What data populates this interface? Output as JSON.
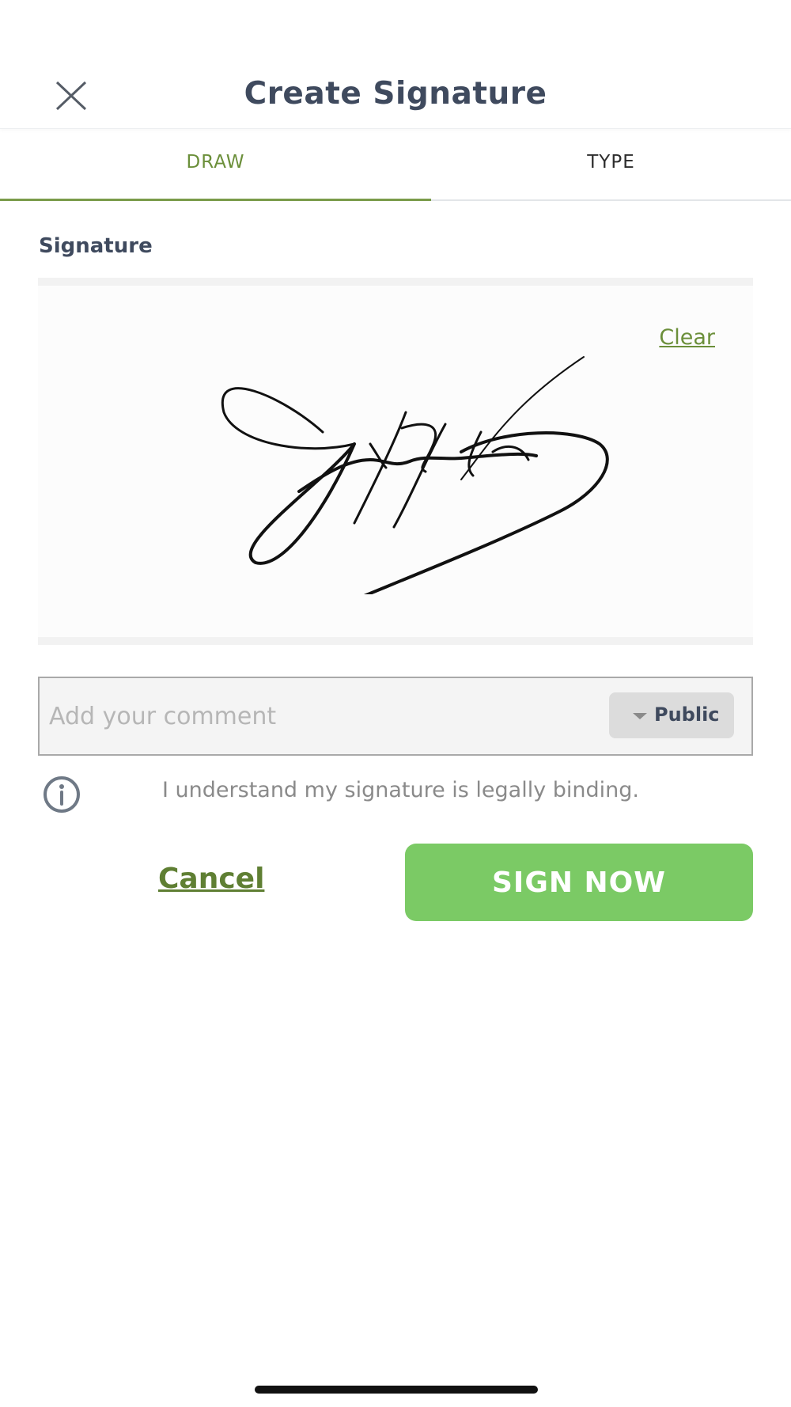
{
  "header": {
    "title": "Create Signature"
  },
  "tabs": [
    {
      "label": "DRAW",
      "active": true
    },
    {
      "label": "TYPE",
      "active": false
    }
  ],
  "signature": {
    "section_label": "Signature",
    "clear_label": "Clear"
  },
  "comment": {
    "placeholder": "Add your comment",
    "value": "",
    "visibility": "Public"
  },
  "legal": {
    "notice": "I understand my signature is legally binding."
  },
  "actions": {
    "cancel_label": "Cancel",
    "sign_label": "SIGN NOW"
  },
  "colors": {
    "accent": "#6b8f3a",
    "sign_button": "#7bca65",
    "title_text": "#3f4a5e"
  },
  "icons": {
    "close": "close-icon",
    "info": "info-icon",
    "dropdown": "caret-down-icon"
  }
}
